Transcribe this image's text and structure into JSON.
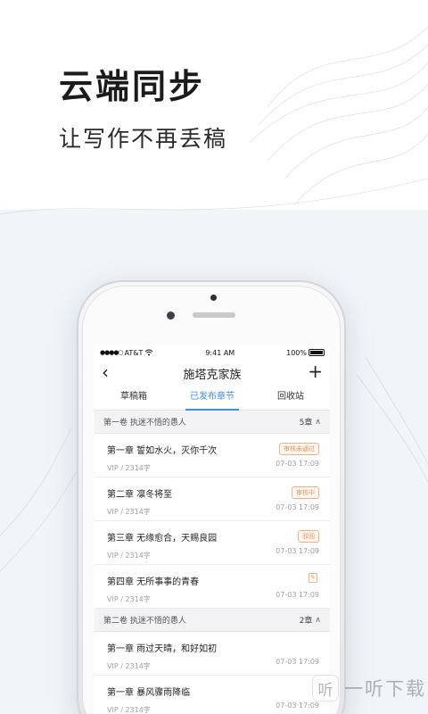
{
  "promo": {
    "headline": "云端同步",
    "subline": "让写作不再丢稿"
  },
  "status_bar": {
    "signal": "●●●●○",
    "carrier": "AT&T",
    "wifi_icon": "wifi-icon",
    "time": "9:41 AM",
    "battery_text": "100%"
  },
  "nav": {
    "back_icon": "‹",
    "title": "施塔克家族",
    "add_icon": "+"
  },
  "tabs": [
    {
      "label": "草稿箱",
      "active": false
    },
    {
      "label": "已发布章节",
      "active": true
    },
    {
      "label": "回收站",
      "active": false
    }
  ],
  "volumes": [
    {
      "title": "第一卷   执迷不悟的愚人",
      "count": "5章",
      "chapters": [
        {
          "title": "第一章   誓如水火，灭你千次",
          "meta": "VIP / 2314字",
          "badge": "审核未通过",
          "date": "07-03   17:09"
        },
        {
          "title": "第二章   凛冬将至",
          "meta": "VIP / 2314字",
          "badge": "审核中",
          "date": "07-03   17:09"
        },
        {
          "title": "第三章   无缘愈合，天赐良园",
          "meta": "VIP / 2314字",
          "badge": "驳回",
          "date": "07-03   17:09"
        },
        {
          "title": "第四章   无所事事的青春",
          "meta": "VIP / 2314字",
          "badge": "",
          "date": "07-03   17:09"
        }
      ]
    },
    {
      "title": "第二卷   执迷不悟的愚人",
      "count": "2章",
      "chapters": [
        {
          "title": "第一章   雨过天晴，和好如初",
          "meta": "VIP / 2314字",
          "badge": "",
          "date": "07-03   17:09"
        },
        {
          "title": "第一章   暴风骤雨降临",
          "meta": "VIP / 2314字",
          "badge": "",
          "date": "07-03   17:09"
        }
      ]
    }
  ],
  "watermark": {
    "icon": "听",
    "text": "一听下载"
  },
  "colors": {
    "accent": "#3a8ee6",
    "badge": "#e8925a",
    "background": "#f1f4f8"
  }
}
